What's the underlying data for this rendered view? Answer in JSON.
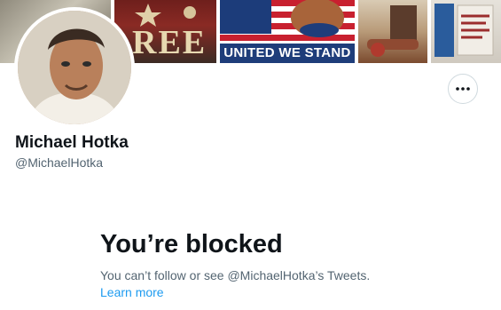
{
  "profile": {
    "name": "Michael Hotka",
    "handle": "@MichaelHotka"
  },
  "banner": {
    "free_text": "REE",
    "stand_text": "UNITED WE STAND"
  },
  "blocked": {
    "title": "You’re blocked",
    "message": "You can’t follow or see @MichaelHotka’s Tweets.",
    "link": "Learn more"
  },
  "icons": {
    "more": "more-horizontal-icon"
  },
  "colors": {
    "link": "#1d9bf0",
    "secondary_text": "#536471",
    "primary_text": "#0f1419"
  }
}
